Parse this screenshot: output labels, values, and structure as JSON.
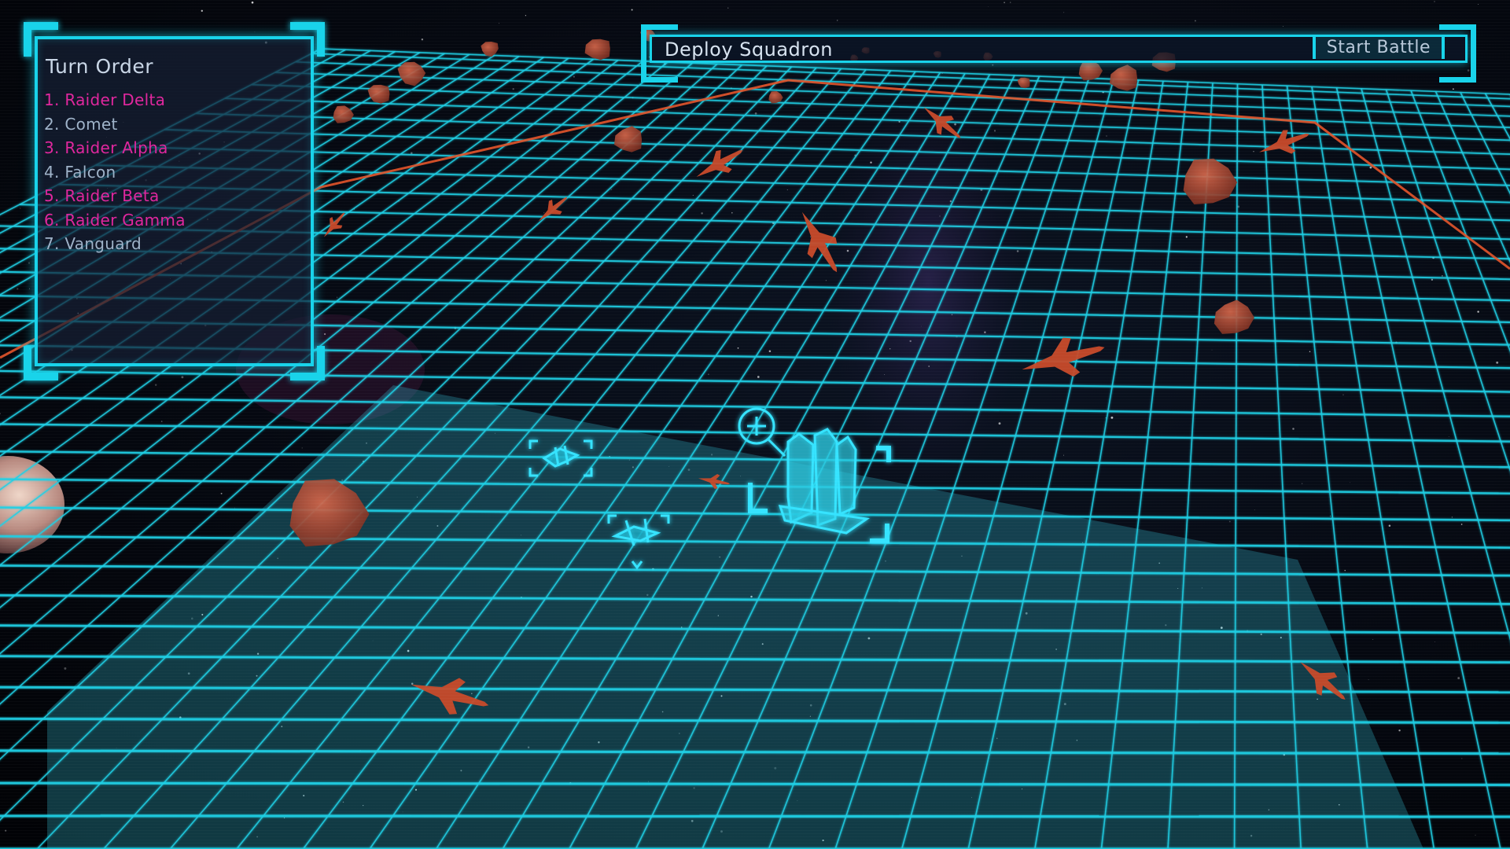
{
  "turn_order": {
    "title": "Turn Order",
    "entries": [
      {
        "label": "1. Raider Delta",
        "side": "enemy"
      },
      {
        "label": "2. Comet",
        "side": "ally"
      },
      {
        "label": "3. Raider Alpha",
        "side": "enemy"
      },
      {
        "label": "4. Falcon",
        "side": "ally"
      },
      {
        "label": "5. Raider Beta",
        "side": "enemy"
      },
      {
        "label": "6. Raider Gamma",
        "side": "enemy"
      },
      {
        "label": "7. Vanguard",
        "side": "ally"
      }
    ]
  },
  "top_bar": {
    "title": "Deploy Squadron",
    "start_button_label": "Start Battle"
  },
  "colors": {
    "hud_accent": "#19d3ea",
    "enemy_text": "#e0279e",
    "ally_text": "#9fb3c9",
    "grid_line": "#1fd0e6",
    "arena_border": "#e4542a",
    "enemy_ship": "#c84a2a",
    "asteroid": "#a84a32"
  },
  "scene": {
    "allied_ships": [
      "fighter-ship",
      "fighter-ship",
      "carrier-ship"
    ],
    "enemy_ships": 9,
    "asteroids": 19
  }
}
